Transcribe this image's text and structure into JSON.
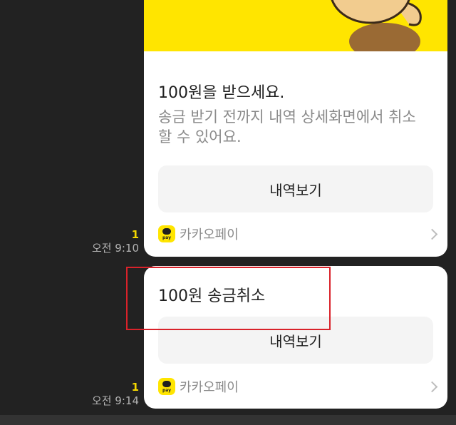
{
  "messages": [
    {
      "unread": "1",
      "time": "오전 9:10",
      "title": "100원을 받으세요.",
      "description": "송금 받기 전까지 내역 상세화면에서 취소할 수 있어요.",
      "button_label": "내역보기",
      "footer_label": "카카오페이",
      "footer_icon": "kakaopay-logo-icon"
    },
    {
      "unread": "1",
      "time": "오전 9:14",
      "title": "100원 송금취소",
      "button_label": "내역보기",
      "footer_label": "카카오페이",
      "footer_icon": "kakaopay-logo-icon"
    }
  ],
  "pay_logo_text": "pay",
  "colors": {
    "background": "#222222",
    "kakao_yellow": "#ffe500",
    "unread": "#f5d800",
    "highlight": "#d9222a"
  }
}
